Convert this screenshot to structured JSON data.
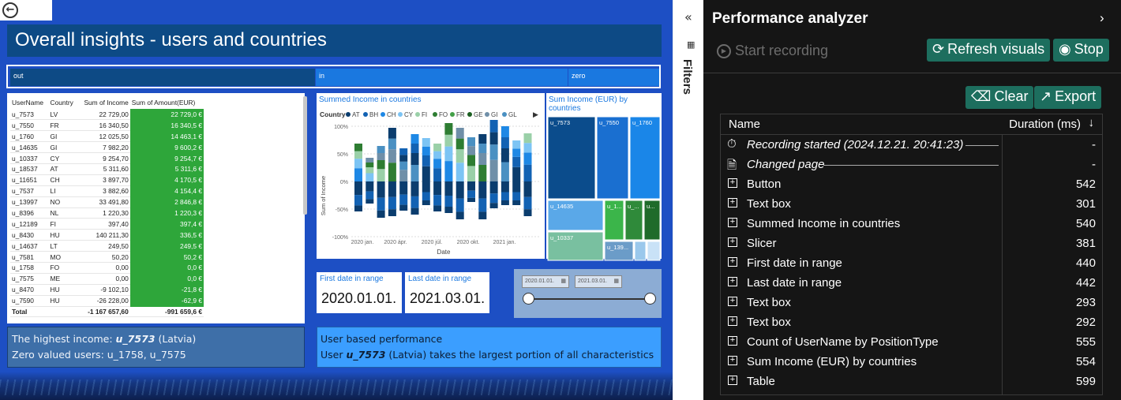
{
  "report": {
    "title": "Overall insights - users and countries",
    "slicer_segments": [
      "out",
      "in",
      "zero"
    ],
    "table": {
      "headers": [
        "UserName",
        "Country",
        "Sum of Income",
        "Sum of Amount(EUR)"
      ],
      "rows": [
        [
          "u_7573",
          "LV",
          "22 729,00",
          "22 729,0 €"
        ],
        [
          "u_7550",
          "FR",
          "16 340,50",
          "16 340,5 €"
        ],
        [
          "u_1760",
          "GI",
          "12 025,50",
          "14 463,1 €"
        ],
        [
          "u_14635",
          "GI",
          "7 982,20",
          "9 600,2 €"
        ],
        [
          "u_10337",
          "CY",
          "9 254,70",
          "9 254,7 €"
        ],
        [
          "u_18537",
          "AT",
          "5 311,60",
          "5 311,6 €"
        ],
        [
          "u_11651",
          "CH",
          "3 897,70",
          "4 170,5 €"
        ],
        [
          "u_7537",
          "LI",
          "3 882,60",
          "4 154,4 €"
        ],
        [
          "u_13997",
          "NO",
          "33 491,80",
          "2 846,8 €"
        ],
        [
          "u_8396",
          "NL",
          "1 220,30",
          "1 220,3 €"
        ],
        [
          "u_12189",
          "FI",
          "397,40",
          "397,4 €"
        ],
        [
          "u_8430",
          "HU",
          "140 211,30",
          "336,5 €"
        ],
        [
          "u_14637",
          "LT",
          "249,50",
          "249,5 €"
        ],
        [
          "u_7581",
          "MO",
          "50,20",
          "50,2 €"
        ],
        [
          "u_1758",
          "FO",
          "0,00",
          "0,0 €"
        ],
        [
          "u_7575",
          "ME",
          "0,00",
          "0,0 €"
        ],
        [
          "u_8470",
          "HU",
          "-9 102,10",
          "-21,8 €"
        ],
        [
          "u_7590",
          "HU",
          "-26 228,00",
          "-62,9 €"
        ]
      ],
      "total": [
        "Total",
        "",
        "-1 167 657,60",
        "-991 659,6 €"
      ]
    },
    "chart_title": "Summed Income in countries",
    "chart_legend_label": "Country",
    "chart_legend": [
      {
        "name": "AT",
        "color": "#0b3d6e"
      },
      {
        "name": "BH",
        "color": "#1262b3"
      },
      {
        "name": "CH",
        "color": "#1e88e5"
      },
      {
        "name": "CY",
        "color": "#7cc4f4"
      },
      {
        "name": "FI",
        "color": "#9ad0a8"
      },
      {
        "name": "FO",
        "color": "#2e7d32"
      },
      {
        "name": "FR",
        "color": "#43a047"
      },
      {
        "name": "GE",
        "color": "#1b5e20"
      },
      {
        "name": "GI",
        "color": "#6f8fa8"
      },
      {
        "name": "GL",
        "color": "#4a90c2"
      }
    ],
    "treemap_title": "Sum Income (EUR) by countries",
    "treemap_labels": [
      "u_7573",
      "u_7550",
      "u_1760",
      "u_14635",
      "u_1...",
      "u_...",
      "u...",
      "u_10337",
      "u_139..."
    ],
    "first_date_label": "First date in range",
    "first_date_value": "2020.01.01.",
    "last_date_label": "Last date in range",
    "last_date_value": "2021.03.01.",
    "range_start": "2020.01.01.",
    "range_end": "2021.03.01.",
    "info_left_line1_prefix": "The highest income: ",
    "info_left_user": "u_7573",
    "info_left_line1_suffix": " (Latvia)",
    "info_left_line2": "Zero valued users: u_1758, u_7575",
    "info_right_line1": "User based performance",
    "info_right_line2_prefix": "User ",
    "info_right_user": "u_7573",
    "info_right_line2_suffix": " (Latvia) takes the largest portion of all characteristics"
  },
  "filters_label": "Filters",
  "performance": {
    "title": "Performance analyzer",
    "start_recording": "Start recording",
    "refresh_visuals": "Refresh visuals",
    "stop": "Stop",
    "clear": "Clear",
    "export": "Export",
    "col_name": "Name",
    "col_duration": "Duration (ms)",
    "events": [
      {
        "name": "Recording started (2024.12.21. 20:41:23)",
        "duration": "-",
        "kind": "timer"
      },
      {
        "name": "Changed page",
        "duration": "-",
        "kind": "page"
      },
      {
        "name": "Button",
        "duration": "542",
        "kind": "plus"
      },
      {
        "name": "Text box",
        "duration": "301",
        "kind": "plus"
      },
      {
        "name": "Summed Income in countries",
        "duration": "540",
        "kind": "plus"
      },
      {
        "name": "Slicer",
        "duration": "381",
        "kind": "plus"
      },
      {
        "name": "First date in range",
        "duration": "440",
        "kind": "plus"
      },
      {
        "name": "Last date in range",
        "duration": "442",
        "kind": "plus"
      },
      {
        "name": "Text box",
        "duration": "293",
        "kind": "plus"
      },
      {
        "name": "Text box",
        "duration": "292",
        "kind": "plus"
      },
      {
        "name": "Count of UserName by PositionType",
        "duration": "555",
        "kind": "plus"
      },
      {
        "name": "Sum Income (EUR) by countries",
        "duration": "554",
        "kind": "plus"
      },
      {
        "name": "Table",
        "duration": "599",
        "kind": "plus"
      }
    ]
  }
}
